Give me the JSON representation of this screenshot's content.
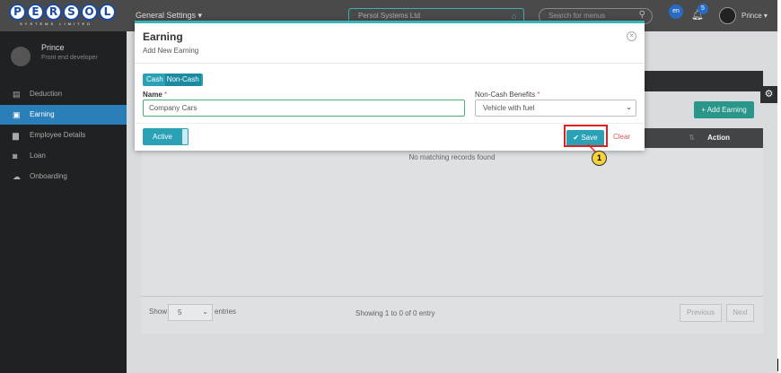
{
  "topbar": {
    "logo_letters": [
      "P",
      "E",
      "R",
      "S",
      "O",
      "L"
    ],
    "logo_sub": "SYSTEMS LIMITED",
    "general_settings": "General Settings ▾",
    "company": "Persol Systems Ltd",
    "search_placeholder": "Search for menus",
    "lang": "en",
    "notif_count": "5",
    "user": "Prince ▾"
  },
  "sidebar": {
    "name": "Prince",
    "role": "Front end developer",
    "items": [
      {
        "label": "Deduction",
        "icon": "▤"
      },
      {
        "label": "Earning",
        "icon": "▣"
      },
      {
        "label": "Employee Details",
        "icon": "▆"
      },
      {
        "label": "Loan",
        "icon": "◙"
      },
      {
        "label": "Onboarding",
        "icon": "☁"
      }
    ]
  },
  "main": {
    "add_earning": "+ Add Earning",
    "table_action": "Action",
    "sort_icon": "⇅",
    "no_records": "No matching records found",
    "show": "Show",
    "entries_value": "5",
    "entries": "entries",
    "showing": "Showing 1 to 0 of 0 entry",
    "previous": "Previous",
    "next": "Next"
  },
  "modal": {
    "title": "Earning",
    "subtitle": "Add New Earning",
    "type_cash": "Cash",
    "type_noncash": "Non-Cash",
    "name_label": "Name",
    "name_value": "Company Cars",
    "ncb_label": "Non-Cash Benefits",
    "ncb_value": "Vehicle with fuel",
    "required_mark": "*",
    "active_label": "Active",
    "save_label": "✔ Save",
    "clear_label": "Clear"
  },
  "callout": {
    "number": "1"
  }
}
